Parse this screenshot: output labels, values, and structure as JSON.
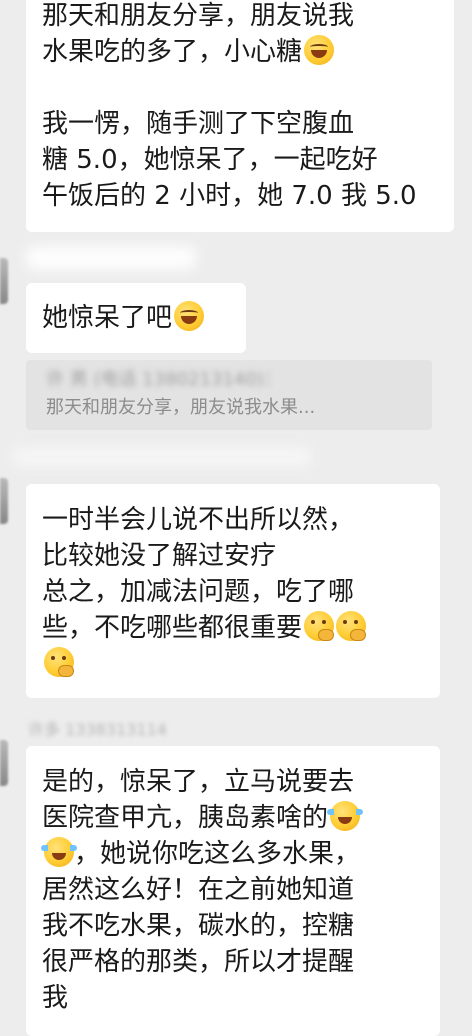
{
  "messages": [
    {
      "lines": [
        "那天和朋友分享，朋友说我",
        "水果吃的多了，小心糖",
        "",
        "我一愣，随手测了下空腹血",
        "糖 5.0，她惊呆了，一起吃好",
        "午饭后的 2 小时，她 7.0 我 5.0"
      ]
    },
    {
      "lines": [
        "她惊呆了吧"
      ]
    },
    {
      "lines": [
        "一时半会儿说不出所以然，",
        "比较她没了解过安疗",
        "总之，加减法问题，吃了哪",
        "些，不吃哪些都很重要"
      ]
    },
    {
      "lines": [
        "是的，惊呆了，立马说要去",
        "医院查甲亢，胰岛素啥的",
        "，她说你吃这么多水果，",
        "居然这么好！在之前她知道",
        "我不吃水果，碳水的，控糖",
        "很严格的那类，所以才提醒",
        "我"
      ]
    }
  ],
  "quote": {
    "sender": "许 男 (电话 1380213140)：",
    "snippet": "那天和朋友分享，朋友说我水果..."
  },
  "blurred": {
    "name_hint": "许多 1338313114"
  },
  "emojis": {
    "laugh": "face-with-tears-of-joy",
    "grin": "grinning-face",
    "think": "face-with-hand-over-mouth",
    "cry": "loudly-crying-face"
  },
  "colors": {
    "background": "#ededed",
    "bubble": "#ffffff",
    "text": "#1a1a1a",
    "quote_bg": "#e3e3e3",
    "quote_text": "#8c8c8c"
  }
}
